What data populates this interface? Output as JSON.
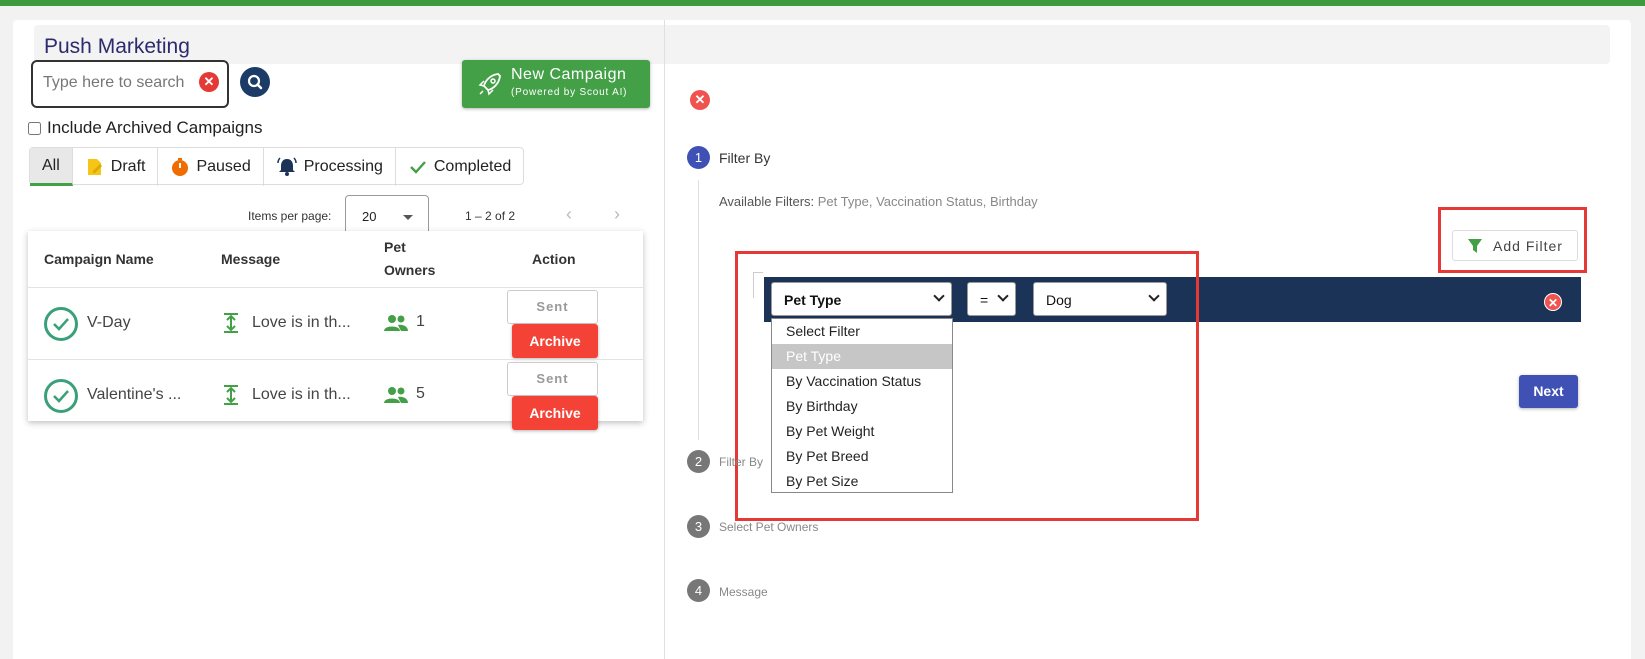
{
  "page": {
    "title": "Push Marketing"
  },
  "search": {
    "placeholder": "Type here to search",
    "value": ""
  },
  "new_campaign": {
    "label": "New Campaign",
    "sublabel": "(Powered by Scout AI)"
  },
  "archived_toggle": {
    "label": "Include Archived Campaigns",
    "checked": false
  },
  "tabs": [
    {
      "label": "All",
      "icon": "none",
      "active": true
    },
    {
      "label": "Draft",
      "icon": "draft-icon",
      "active": false
    },
    {
      "label": "Paused",
      "icon": "timer-icon",
      "active": false
    },
    {
      "label": "Processing",
      "icon": "bell-icon",
      "active": false
    },
    {
      "label": "Completed",
      "icon": "check-icon",
      "active": false
    }
  ],
  "pagination": {
    "items_per_page_label": "Items per page:",
    "items_per_page": "20",
    "range": "1 – 2 of 2"
  },
  "table": {
    "headers": {
      "name": "Campaign Name",
      "message": "Message",
      "owners_line1": "Pet",
      "owners_line2": "Owners",
      "action": "Action"
    },
    "rows": [
      {
        "name": "V-Day",
        "message": "Love is in th...",
        "owners": "1",
        "sent": "Sent",
        "archive": "Archive"
      },
      {
        "name": "Valentine's ...",
        "message": "Love is in th...",
        "owners": "5",
        "sent": "Sent",
        "archive": "Archive"
      }
    ]
  },
  "wizard": {
    "steps": [
      {
        "num": "1",
        "label": "Filter By",
        "active": true
      },
      {
        "num": "2",
        "label": "Filter By",
        "active": false
      },
      {
        "num": "3",
        "label": "Select Pet Owners",
        "active": false
      },
      {
        "num": "4",
        "label": "Message",
        "active": false
      }
    ],
    "available_label": "Available Filters:",
    "available_values": "Pet Type, Vaccination Status, Birthday",
    "add_filter": "Add Filter",
    "next": "Next"
  },
  "filter_row": {
    "field": "Pet Type",
    "operator": "=",
    "value": "Dog"
  },
  "dropdown": {
    "options": [
      "Select Filter",
      "Pet Type",
      "By Vaccination Status",
      "By Birthday",
      "By Pet Weight",
      "By Pet Breed",
      "By Pet Size"
    ],
    "selected_index": 1
  },
  "colors": {
    "brand_green": "#43a047",
    "navy": "#1c3358",
    "danger": "#f44336",
    "step_active": "#3f51b5",
    "step_inactive": "#777777"
  }
}
